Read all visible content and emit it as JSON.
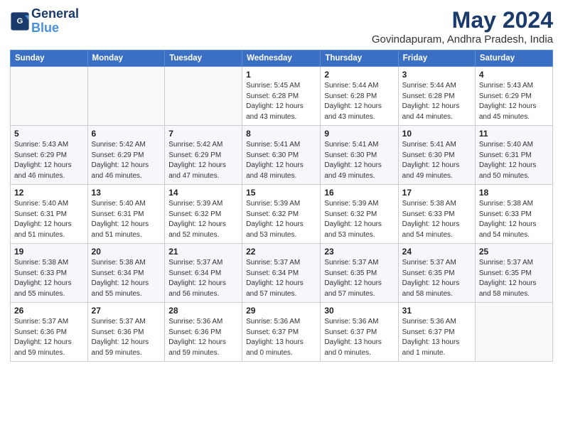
{
  "logo": {
    "line1": "General",
    "line2": "Blue"
  },
  "title": "May 2024",
  "location": "Govindapuram, Andhra Pradesh, India",
  "weekdays": [
    "Sunday",
    "Monday",
    "Tuesday",
    "Wednesday",
    "Thursday",
    "Friday",
    "Saturday"
  ],
  "weeks": [
    [
      {
        "day": "",
        "info": ""
      },
      {
        "day": "",
        "info": ""
      },
      {
        "day": "",
        "info": ""
      },
      {
        "day": "1",
        "info": "Sunrise: 5:45 AM\nSunset: 6:28 PM\nDaylight: 12 hours\nand 43 minutes."
      },
      {
        "day": "2",
        "info": "Sunrise: 5:44 AM\nSunset: 6:28 PM\nDaylight: 12 hours\nand 43 minutes."
      },
      {
        "day": "3",
        "info": "Sunrise: 5:44 AM\nSunset: 6:28 PM\nDaylight: 12 hours\nand 44 minutes."
      },
      {
        "day": "4",
        "info": "Sunrise: 5:43 AM\nSunset: 6:29 PM\nDaylight: 12 hours\nand 45 minutes."
      }
    ],
    [
      {
        "day": "5",
        "info": "Sunrise: 5:43 AM\nSunset: 6:29 PM\nDaylight: 12 hours\nand 46 minutes."
      },
      {
        "day": "6",
        "info": "Sunrise: 5:42 AM\nSunset: 6:29 PM\nDaylight: 12 hours\nand 46 minutes."
      },
      {
        "day": "7",
        "info": "Sunrise: 5:42 AM\nSunset: 6:29 PM\nDaylight: 12 hours\nand 47 minutes."
      },
      {
        "day": "8",
        "info": "Sunrise: 5:41 AM\nSunset: 6:30 PM\nDaylight: 12 hours\nand 48 minutes."
      },
      {
        "day": "9",
        "info": "Sunrise: 5:41 AM\nSunset: 6:30 PM\nDaylight: 12 hours\nand 49 minutes."
      },
      {
        "day": "10",
        "info": "Sunrise: 5:41 AM\nSunset: 6:30 PM\nDaylight: 12 hours\nand 49 minutes."
      },
      {
        "day": "11",
        "info": "Sunrise: 5:40 AM\nSunset: 6:31 PM\nDaylight: 12 hours\nand 50 minutes."
      }
    ],
    [
      {
        "day": "12",
        "info": "Sunrise: 5:40 AM\nSunset: 6:31 PM\nDaylight: 12 hours\nand 51 minutes."
      },
      {
        "day": "13",
        "info": "Sunrise: 5:40 AM\nSunset: 6:31 PM\nDaylight: 12 hours\nand 51 minutes."
      },
      {
        "day": "14",
        "info": "Sunrise: 5:39 AM\nSunset: 6:32 PM\nDaylight: 12 hours\nand 52 minutes."
      },
      {
        "day": "15",
        "info": "Sunrise: 5:39 AM\nSunset: 6:32 PM\nDaylight: 12 hours\nand 53 minutes."
      },
      {
        "day": "16",
        "info": "Sunrise: 5:39 AM\nSunset: 6:32 PM\nDaylight: 12 hours\nand 53 minutes."
      },
      {
        "day": "17",
        "info": "Sunrise: 5:38 AM\nSunset: 6:33 PM\nDaylight: 12 hours\nand 54 minutes."
      },
      {
        "day": "18",
        "info": "Sunrise: 5:38 AM\nSunset: 6:33 PM\nDaylight: 12 hours\nand 54 minutes."
      }
    ],
    [
      {
        "day": "19",
        "info": "Sunrise: 5:38 AM\nSunset: 6:33 PM\nDaylight: 12 hours\nand 55 minutes."
      },
      {
        "day": "20",
        "info": "Sunrise: 5:38 AM\nSunset: 6:34 PM\nDaylight: 12 hours\nand 55 minutes."
      },
      {
        "day": "21",
        "info": "Sunrise: 5:37 AM\nSunset: 6:34 PM\nDaylight: 12 hours\nand 56 minutes."
      },
      {
        "day": "22",
        "info": "Sunrise: 5:37 AM\nSunset: 6:34 PM\nDaylight: 12 hours\nand 57 minutes."
      },
      {
        "day": "23",
        "info": "Sunrise: 5:37 AM\nSunset: 6:35 PM\nDaylight: 12 hours\nand 57 minutes."
      },
      {
        "day": "24",
        "info": "Sunrise: 5:37 AM\nSunset: 6:35 PM\nDaylight: 12 hours\nand 58 minutes."
      },
      {
        "day": "25",
        "info": "Sunrise: 5:37 AM\nSunset: 6:35 PM\nDaylight: 12 hours\nand 58 minutes."
      }
    ],
    [
      {
        "day": "26",
        "info": "Sunrise: 5:37 AM\nSunset: 6:36 PM\nDaylight: 12 hours\nand 59 minutes."
      },
      {
        "day": "27",
        "info": "Sunrise: 5:37 AM\nSunset: 6:36 PM\nDaylight: 12 hours\nand 59 minutes."
      },
      {
        "day": "28",
        "info": "Sunrise: 5:36 AM\nSunset: 6:36 PM\nDaylight: 12 hours\nand 59 minutes."
      },
      {
        "day": "29",
        "info": "Sunrise: 5:36 AM\nSunset: 6:37 PM\nDaylight: 13 hours\nand 0 minutes."
      },
      {
        "day": "30",
        "info": "Sunrise: 5:36 AM\nSunset: 6:37 PM\nDaylight: 13 hours\nand 0 minutes."
      },
      {
        "day": "31",
        "info": "Sunrise: 5:36 AM\nSunset: 6:37 PM\nDaylight: 13 hours\nand 1 minute."
      },
      {
        "day": "",
        "info": ""
      }
    ]
  ]
}
